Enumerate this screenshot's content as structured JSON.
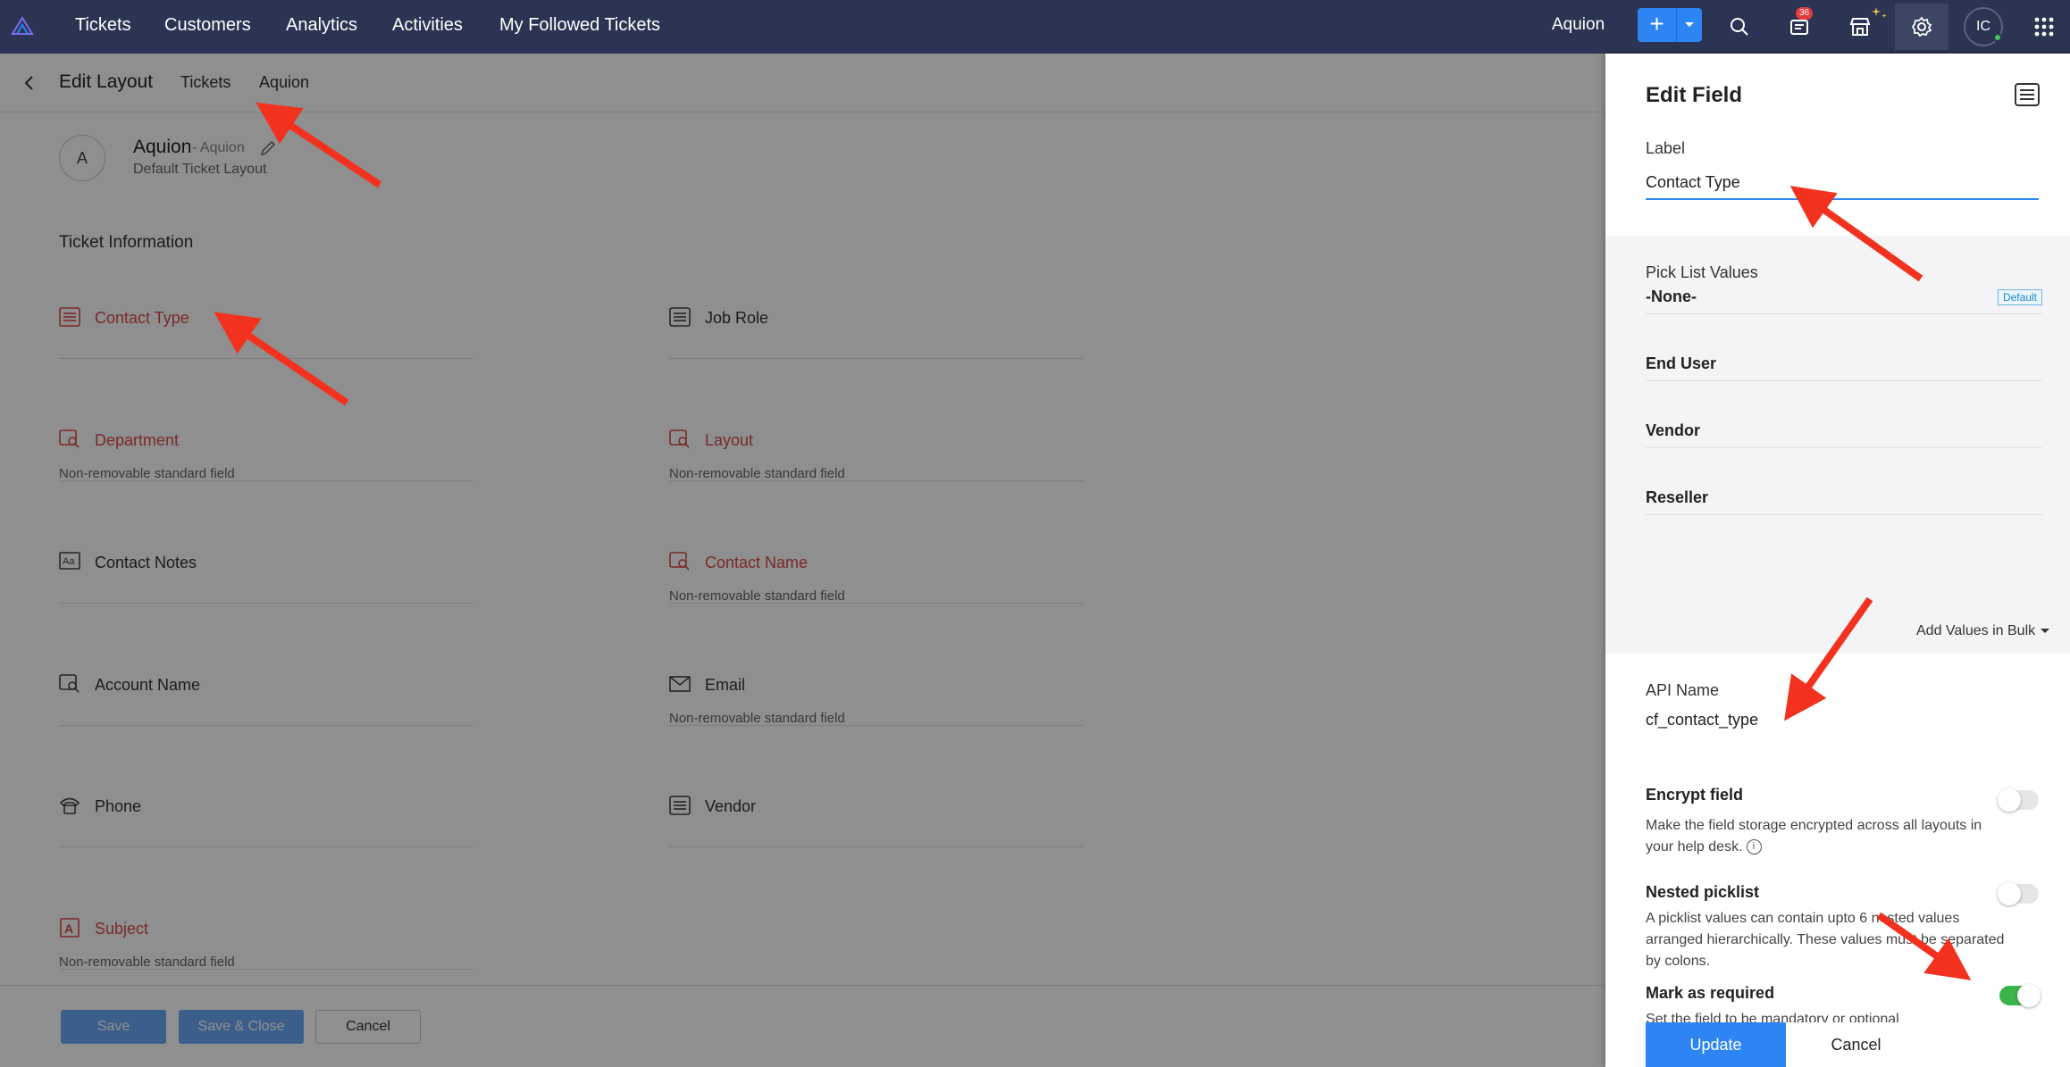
{
  "topnav": {
    "items": [
      "Tickets",
      "Customers",
      "Analytics",
      "Activities",
      "My Followed Tickets"
    ],
    "org_name": "Aquion",
    "add_symbol": "+",
    "notification_count": "36",
    "avatar_initials": "IC"
  },
  "subheader": {
    "title": "Edit Layout",
    "breadcrumbs": [
      "Tickets",
      "Aquion"
    ]
  },
  "layout_info": {
    "avatar_letter": "A",
    "name": "Aquion",
    "sub": "- Aquion",
    "description": "Default Ticket Layout"
  },
  "section_title": "Ticket Information",
  "fields": [
    {
      "label": "Contact Type",
      "note": "",
      "required": true,
      "icon": "picklist-icon"
    },
    {
      "label": "Job Role",
      "note": "",
      "required": false,
      "icon": "picklist-icon"
    },
    {
      "label": "Department",
      "note": "Non-removable standard field",
      "required": true,
      "icon": "lookup-icon"
    },
    {
      "label": "Layout",
      "note": "Non-removable standard field",
      "required": true,
      "icon": "lookup-icon"
    },
    {
      "label": "Contact Notes",
      "note": "",
      "required": false,
      "icon": "text-area-icon"
    },
    {
      "label": "Contact Name",
      "note": "Non-removable standard field",
      "required": true,
      "icon": "lookup-icon"
    },
    {
      "label": "Account Name",
      "note": "",
      "required": false,
      "icon": "lookup-icon"
    },
    {
      "label": "Email",
      "note": "Non-removable standard field",
      "required": false,
      "icon": "email-icon"
    },
    {
      "label": "Phone",
      "note": "",
      "required": false,
      "icon": "phone-icon"
    },
    {
      "label": "Vendor",
      "note": "",
      "required": false,
      "icon": "picklist-icon"
    },
    {
      "label": "Subject",
      "note": "Non-removable standard field",
      "required": true,
      "icon": "text-field-icon"
    }
  ],
  "footer": {
    "save": "Save",
    "save_close": "Save & Close",
    "cancel": "Cancel"
  },
  "edit_field": {
    "title": "Edit Field",
    "label_caption": "Label",
    "label_value": "Contact Type",
    "picklist_title": "Pick List Values",
    "picklist_values": [
      "-None-",
      "End User",
      "Vendor",
      "Reseller"
    ],
    "default_tag": "Default",
    "add_bulk": "Add Values in Bulk",
    "api_caption": "API Name",
    "api_value": "cf_contact_type",
    "encrypt_title": "Encrypt field",
    "encrypt_desc": "Make the field storage encrypted across all layouts in your help desk.",
    "info_symbol": "i",
    "nested_title": "Nested picklist",
    "nested_desc": "A picklist values can contain upto 6 nested values arranged hierarchically. These values must be separated by colons.",
    "required_title": "Mark as required",
    "required_desc": "Set the field to be mandatory or optional",
    "update": "Update",
    "cancel": "Cancel",
    "toggles": {
      "encrypt": false,
      "nested": false,
      "required": true
    }
  },
  "colors": {
    "topbar": "#2b3452",
    "accent": "#2d84f3",
    "required_label": "#d94b4b",
    "toggle_on": "#3bb54a",
    "annotation_arrow": "#f2321e"
  }
}
